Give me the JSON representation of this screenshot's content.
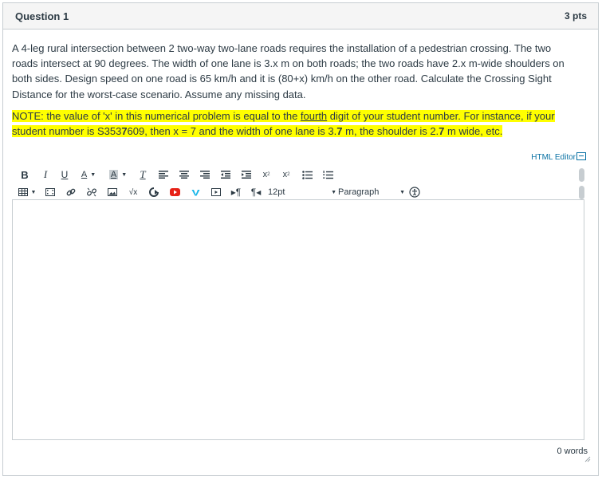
{
  "question": {
    "title": "Question 1",
    "points": "3 pts",
    "text": "A 4-leg rural intersection between 2 two-way two-lane roads requires the installation of a pedestrian crossing. The two roads intersect at 90 degrees. The width of one lane is 3.x m on both roads; the two roads have 2.x m-wide shoulders on both sides. Design speed on one road is 65 km/h and it is (80+x) km/h on the other road. Calculate the Crossing Sight Distance for the worst-case scenario. Assume any missing data.",
    "note": {
      "part1": "NOTE: the value of 'x' in this numerical problem is equal to the ",
      "underlined": "fourth",
      "part2": " digit of your student number. For instance, if your student number is S353",
      "bold_digit1": "7",
      "part3": "609, then x = 7 and the width of one lane is 3.",
      "bold_digit2": "7",
      "part4": " m, the shoulder is 2.",
      "bold_digit3": "7",
      "part5": " m wide, etc."
    }
  },
  "editor": {
    "html_editor_link": "HTML Editor",
    "font_size": "12pt",
    "block_format": "Paragraph",
    "word_count": "0 words",
    "youtube_color": "#e62117",
    "vimeo_color": "#1ab7ea",
    "link_color": "#0770a3",
    "highlight_color": "#ffff00"
  }
}
